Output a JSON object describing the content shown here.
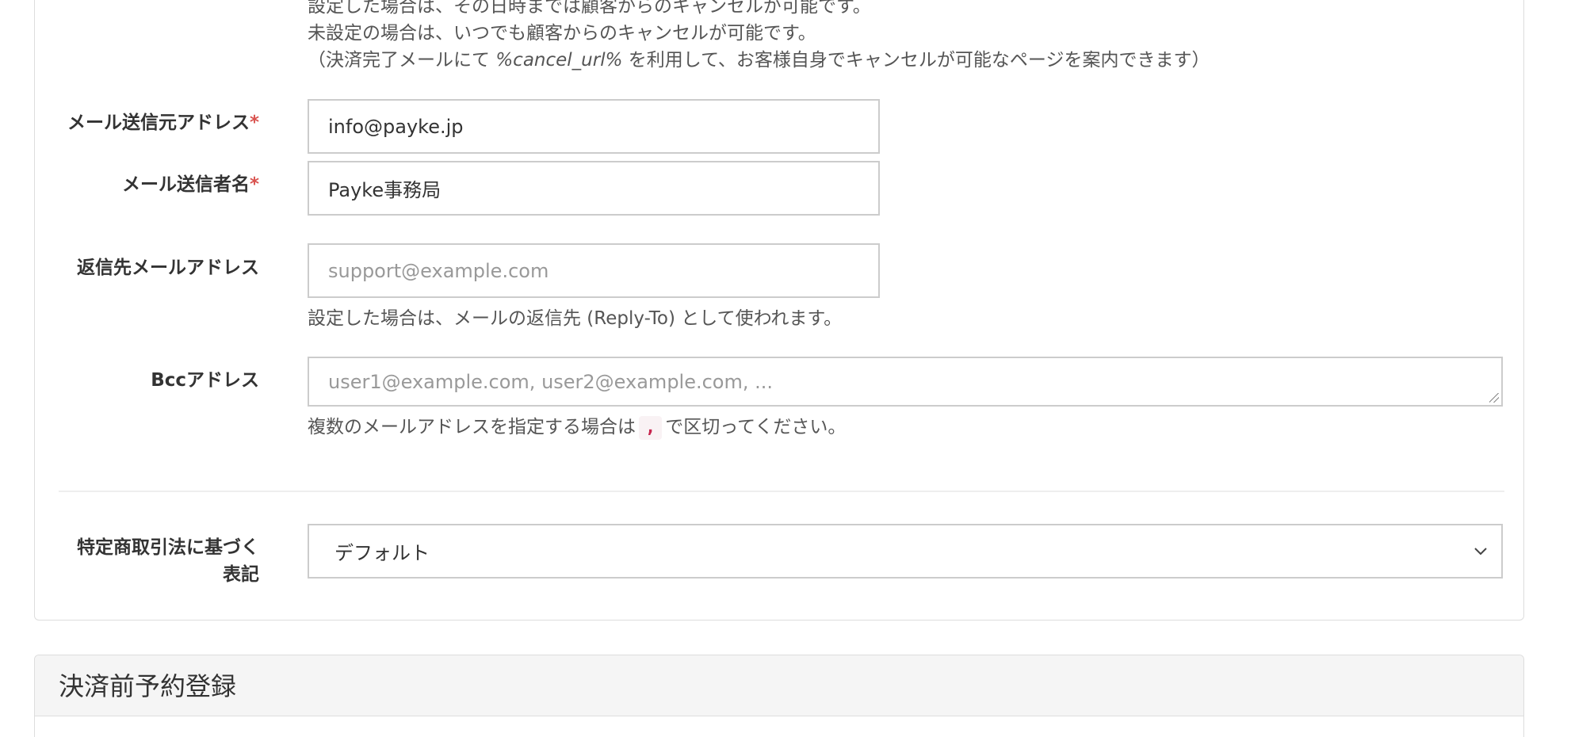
{
  "cancel_help": {
    "line1": "設定した場合は、その日時までは顧客からのキャンセルが可能です。",
    "line2": "未設定の場合は、いつでも顧客からのキャンセルが可能です。",
    "line3_prefix": "（決済完了メールにて ",
    "line3_code": "%cancel_url%",
    "line3_suffix": " を利用して、お客様自身でキャンセルが可能なページを案内できます）"
  },
  "fields": {
    "sender_address": {
      "label": "メール送信元アドレス",
      "required_mark": "*",
      "value": "info@payke.jp"
    },
    "sender_name": {
      "label": "メール送信者名",
      "required_mark": "*",
      "value": "Payke事務局"
    },
    "reply_to": {
      "label": "返信先メールアドレス",
      "placeholder": "support@example.com",
      "help": "設定した場合は、メールの返信先 (Reply-To) として使われます。"
    },
    "bcc": {
      "label": "Bccアドレス",
      "placeholder": "user1@example.com, user2@example.com, ...",
      "help_prefix": "複数のメールアドレスを指定する場合は",
      "help_code": ",",
      "help_suffix": "で区切ってください。"
    },
    "commerce_law": {
      "label_line1": "特定商取引法に基づく",
      "label_line2": "表記",
      "selected": "デフォルト"
    }
  },
  "next_panel": {
    "title": "決済前予約登録"
  },
  "icons": {
    "select_arrow": "chevron-down-icon"
  }
}
